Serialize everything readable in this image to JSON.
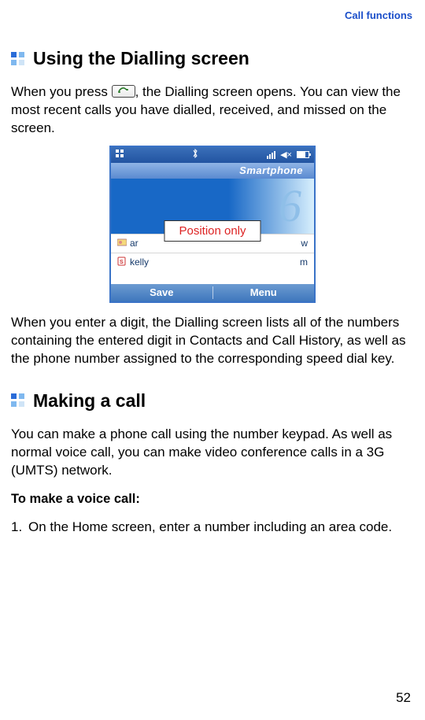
{
  "header": {
    "breadcrumb": "Call functions"
  },
  "section1": {
    "title": "Using the Dialling screen",
    "para1_a": "When you press ",
    "para1_b": ", the Dialling screen opens. You can view the most recent calls you have dialled, received, and missed on the screen.",
    "para2": "When you enter a digit, the Dialling screen lists all of the numbers containing the entered digit in Contacts and Call History, as well as the phone number assigned to the corresponding speed dial key."
  },
  "phone": {
    "title": "Smartphone",
    "digit": "6",
    "rows": [
      {
        "icon": "card",
        "name": "ar",
        "right": "w"
      },
      {
        "icon": "sim",
        "name": "kelly",
        "right": "m"
      }
    ],
    "softkeys": {
      "left": "Save",
      "right": "Menu"
    },
    "overlay": "Position only"
  },
  "section2": {
    "title": "Making a call",
    "para1": "You can make a phone call using the number keypad. As well as normal voice call, you can make video conference calls in a 3G (UMTS) network.",
    "subhead": "To make a voice call:",
    "steps": [
      {
        "n": "1.",
        "t": "On the Home screen, enter a number including an area code."
      }
    ]
  },
  "page_number": "52"
}
